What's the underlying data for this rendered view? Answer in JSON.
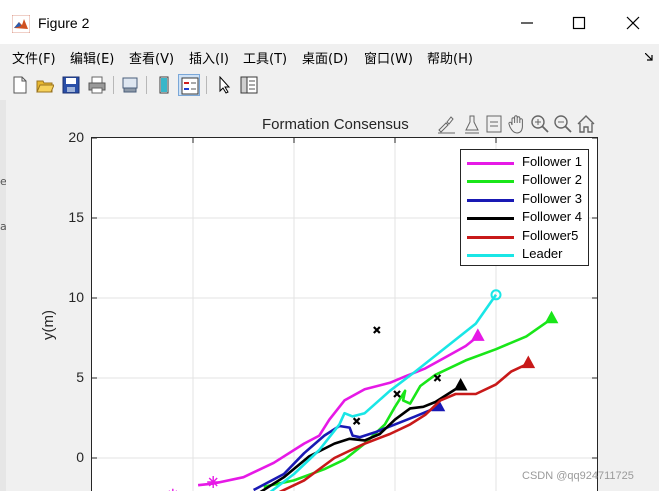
{
  "window": {
    "title": "Figure 2",
    "minimize_icon": "minimize-icon",
    "maximize_icon": "maximize-icon",
    "close_icon": "close-icon"
  },
  "menubar": {
    "items": [
      "文件(F)",
      "编辑(E)",
      "查看(V)",
      "插入(I)",
      "工具(T)",
      "桌面(D)",
      "窗口(W)",
      "帮助(H)"
    ]
  },
  "toolbar": {
    "icons": [
      "new-figure-icon",
      "open-file-icon",
      "save-icon",
      "print-icon",
      "print-preview-icon",
      "colorbar-icon",
      "legend-icon",
      "edit-plot-icon",
      "property-inspector-icon"
    ]
  },
  "left_edge_letters": [
    "e",
    "a"
  ],
  "axes": {
    "title": "Formation Consensus",
    "ylabel": "y(m)",
    "toolbar_icons": [
      "brush-icon",
      "data-tip-icon",
      "zoom-box-icon",
      "pan-icon",
      "zoom-in-icon",
      "zoom-out-icon",
      "home-icon"
    ]
  },
  "chart_data": {
    "type": "line",
    "title": "Formation Consensus",
    "ylabel": "y(m)",
    "ylim": [
      -1.5,
      20
    ],
    "yticks": [
      "20",
      "15",
      "10",
      "5",
      "0"
    ],
    "grid": true,
    "legend_position": "top-right",
    "series": [
      {
        "name": "Follower 1",
        "color": "#e619e6",
        "marker": "triangle",
        "end": [
          38.2,
          7.6
        ],
        "points": [
          [
            10.5,
            -1.7
          ],
          [
            12,
            -1.6
          ],
          [
            15,
            -1.2
          ],
          [
            18,
            -0.3
          ],
          [
            21,
            0.9
          ],
          [
            22.5,
            1.4
          ],
          [
            23.5,
            2.4
          ],
          [
            25,
            3.6
          ],
          [
            27,
            4.3
          ],
          [
            29.5,
            4.7
          ],
          [
            31,
            5.1
          ],
          [
            33,
            5.6
          ],
          [
            35,
            6.3
          ],
          [
            37,
            7.0
          ],
          [
            38.2,
            7.6
          ]
        ]
      },
      {
        "name": "Follower 2",
        "color": "#19e619",
        "marker": "triangle",
        "end": [
          45.5,
          8.7
        ],
        "points": [
          [
            17,
            -1.8
          ],
          [
            20,
            -1.4
          ],
          [
            23,
            -0.7
          ],
          [
            25,
            -0.1
          ],
          [
            27,
            0.9
          ],
          [
            29,
            2.1
          ],
          [
            30,
            3.2
          ],
          [
            31,
            4.2
          ],
          [
            30.8,
            3.6
          ],
          [
            31.5,
            3.4
          ],
          [
            32.5,
            4.5
          ],
          [
            34,
            5.2
          ],
          [
            37,
            6.1
          ],
          [
            40,
            6.8
          ],
          [
            43,
            7.6
          ],
          [
            45.5,
            8.7
          ]
        ]
      },
      {
        "name": "Follower 3",
        "color": "#1919b4",
        "marker": "triangle",
        "end": [
          34.3,
          3.2
        ],
        "points": [
          [
            16,
            -2.0
          ],
          [
            19,
            -1.0
          ],
          [
            21,
            0.3
          ],
          [
            23,
            1.4
          ],
          [
            24.5,
            2.0
          ],
          [
            25.5,
            1.9
          ],
          [
            25.8,
            1.4
          ],
          [
            26.5,
            1.3
          ],
          [
            28,
            1.6
          ],
          [
            30,
            2.1
          ],
          [
            32,
            2.6
          ],
          [
            34.3,
            3.2
          ]
        ]
      },
      {
        "name": "Follower 4",
        "color": "#000000",
        "marker": "triangle",
        "end": [
          36.5,
          4.5
        ],
        "points": [
          [
            16.5,
            -2.2
          ],
          [
            19,
            -1.2
          ],
          [
            21.5,
            0.1
          ],
          [
            24,
            0.9
          ],
          [
            25.5,
            1.2
          ],
          [
            27,
            1.1
          ],
          [
            28.5,
            1.5
          ],
          [
            30,
            2.4
          ],
          [
            31.5,
            3.1
          ],
          [
            32.8,
            3.2
          ],
          [
            34,
            3.5
          ],
          [
            35.5,
            4.1
          ],
          [
            36.5,
            4.5
          ]
        ]
      },
      {
        "name": "Follower5",
        "color": "#c81919",
        "marker": "triangle",
        "end": [
          43.2,
          5.9
        ],
        "points": [
          [
            18,
            -2.3
          ],
          [
            21,
            -1.4
          ],
          [
            24,
            0.0
          ],
          [
            27,
            0.9
          ],
          [
            29.5,
            1.5
          ],
          [
            31.5,
            2.1
          ],
          [
            33,
            2.7
          ],
          [
            34.5,
            3.6
          ],
          [
            36,
            4.0
          ],
          [
            38,
            4.0
          ],
          [
            40,
            4.6
          ],
          [
            41.5,
            5.4
          ],
          [
            43.2,
            5.9
          ]
        ]
      },
      {
        "name": "Leader",
        "color": "#19e6e6",
        "marker": "circle",
        "end": [
          40,
          10.2
        ],
        "points": [
          [
            17.5,
            -2.2
          ],
          [
            20,
            -1.0
          ],
          [
            22.5,
            0.5
          ],
          [
            24.5,
            2.1
          ],
          [
            25,
            2.8
          ],
          [
            25.8,
            2.6
          ],
          [
            27,
            2.8
          ],
          [
            29.5,
            4.2
          ],
          [
            32,
            5.4
          ],
          [
            35,
            6.9
          ],
          [
            38,
            8.4
          ],
          [
            40,
            10.2
          ]
        ]
      }
    ],
    "crosses": [
      [
        28.2,
        8.0
      ],
      [
        26.2,
        2.3
      ],
      [
        30.2,
        4.0
      ],
      [
        34.2,
        5.0
      ]
    ],
    "stars": [
      [
        12,
        -1.5
      ],
      [
        8,
        -2.3
      ]
    ]
  },
  "watermark": "CSDN @qq924711725"
}
